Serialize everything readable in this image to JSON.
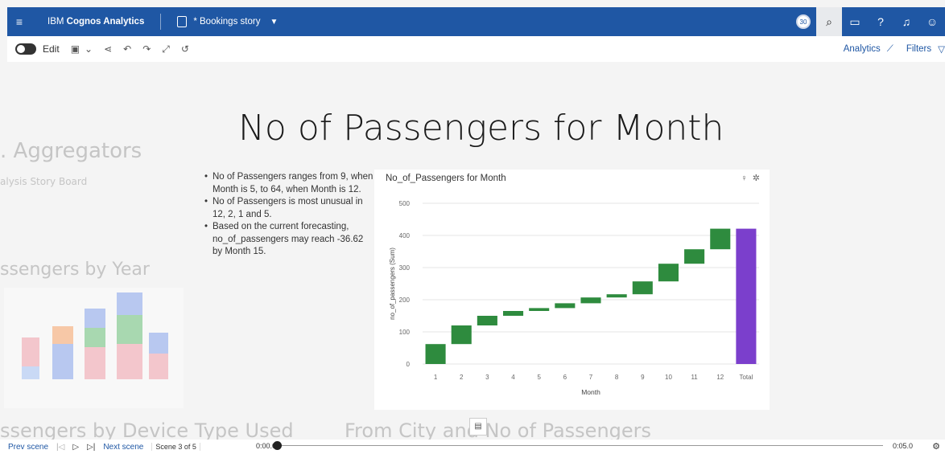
{
  "topbar": {
    "menu_icon": "hamburger-icon",
    "brand_prefix": "IBM ",
    "brand_name": "Cognos Analytics",
    "story_title": "* Bookings story",
    "avatar_badge": "30",
    "icons": [
      "search-icon",
      "chat-icon",
      "help-icon",
      "bell-icon",
      "user-icon"
    ]
  },
  "toolbar": {
    "edit_label": "Edit",
    "analytics_label": "Analytics",
    "filters_label": "Filters"
  },
  "background_scenes": {
    "aggregators": "Aggregators",
    "story_board": "alysis Story Board",
    "passengers_by_year": "ssengers by Year",
    "by_device": "ssengers by Device Type Used",
    "from_city": "From City and No of Passengers"
  },
  "scene": {
    "title": "No of Passengers for Month",
    "insights": [
      "No of Passengers ranges from 9, when Month is 5, to 64, when Month is 12.",
      "No of Passengers is most unusual in 12, 2, 1 and 5.",
      "Based on the current forecasting, no_of_passengers may reach -36.62 by Month 15."
    ]
  },
  "chart_data": {
    "type": "waterfall",
    "title": "No_of_Passengers for Month",
    "xlabel": "Month",
    "ylabel": "no_of_passengers (Sum)",
    "ylim": [
      0,
      500
    ],
    "yticks": [
      0,
      100,
      200,
      300,
      400,
      500
    ],
    "categories": [
      "1",
      "2",
      "3",
      "4",
      "5",
      "6",
      "7",
      "8",
      "9",
      "10",
      "11",
      "12",
      "Total"
    ],
    "values": [
      62,
      58,
      30,
      15,
      9,
      15,
      18,
      10,
      40,
      55,
      45,
      64,
      421
    ],
    "colors": {
      "increase": "#2e8b3e",
      "total": "#7b3fcc"
    }
  },
  "bottombar": {
    "prev": "Prev scene",
    "next": "Next scene",
    "scene_label": "Scene 3 of 5",
    "time_start": "0:00.0",
    "time_end": "0:05.0"
  }
}
